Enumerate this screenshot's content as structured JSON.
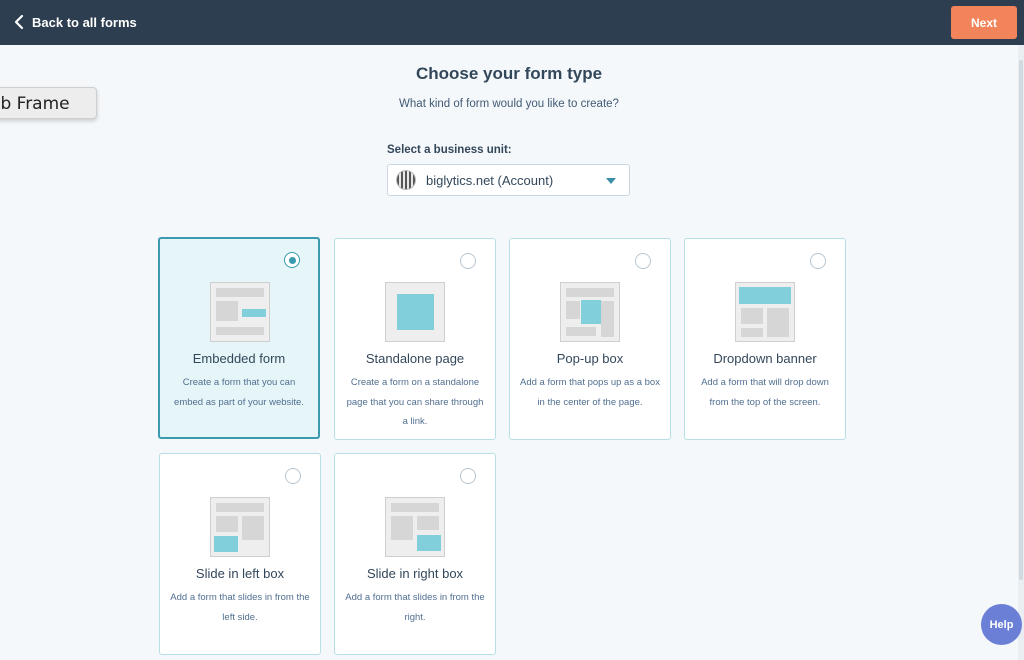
{
  "header": {
    "back_label": "Back to all forms",
    "next_label": "Next",
    "accent_color": "#f2845c",
    "bar_color": "#2d3e50"
  },
  "overlay": {
    "frame_tag": "eb Frame"
  },
  "main": {
    "title": "Choose your form type",
    "subtitle": "What kind of form would you like to create?",
    "business_unit_label": "Select a business unit:",
    "business_unit_value": "biglytics.net (Account)"
  },
  "form_types": [
    {
      "title": "Embedded form",
      "desc": "Create a form that you can embed as part of your website.",
      "selected": true,
      "icon": "embedded-form-icon"
    },
    {
      "title": "Standalone page",
      "desc": "Create a form on a standalone page that you can share through a link.",
      "selected": false,
      "icon": "standalone-page-icon"
    },
    {
      "title": "Pop-up box",
      "desc": "Add a form that pops up as a box in the center of the page.",
      "selected": false,
      "icon": "popup-box-icon"
    },
    {
      "title": "Dropdown banner",
      "desc": "Add a form that will drop down from the top of the screen.",
      "selected": false,
      "icon": "dropdown-banner-icon"
    },
    {
      "title": "Slide in left box",
      "desc": "Add a form that slides in from the left side.",
      "selected": false,
      "icon": "slide-in-left-icon"
    },
    {
      "title": "Slide in right box",
      "desc": "Add a form that slides in from the right.",
      "selected": false,
      "icon": "slide-in-right-icon"
    }
  ],
  "help": {
    "label": "Help"
  }
}
